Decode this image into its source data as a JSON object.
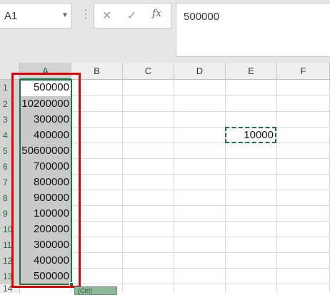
{
  "name_box": {
    "value": "A1",
    "dropdown_icon": "chevron-down-icon"
  },
  "formula_bar": {
    "cancel_icon": "close-icon",
    "confirm_icon": "check-icon",
    "fx_label": "fx",
    "value": "500000"
  },
  "columns": [
    "A",
    "B",
    "C",
    "D",
    "E",
    "F"
  ],
  "rows": [
    "1",
    "2",
    "3",
    "4",
    "5",
    "6",
    "7",
    "8",
    "9",
    "10",
    "11",
    "12",
    "13",
    "14"
  ],
  "column_a_values": [
    "500000",
    "10200000",
    "300000",
    "400000",
    "50600000",
    "700000",
    "800000",
    "900000",
    "100000",
    "200000",
    "300000",
    "400000",
    "500000"
  ],
  "cell_e4": "10000",
  "paste_options": {
    "label": "(Ctrl)",
    "icon": "clipboard-icon"
  },
  "colors": {
    "selection": "#217346",
    "highlight": "#e00000",
    "selected_fill": "#c9c9c9"
  }
}
